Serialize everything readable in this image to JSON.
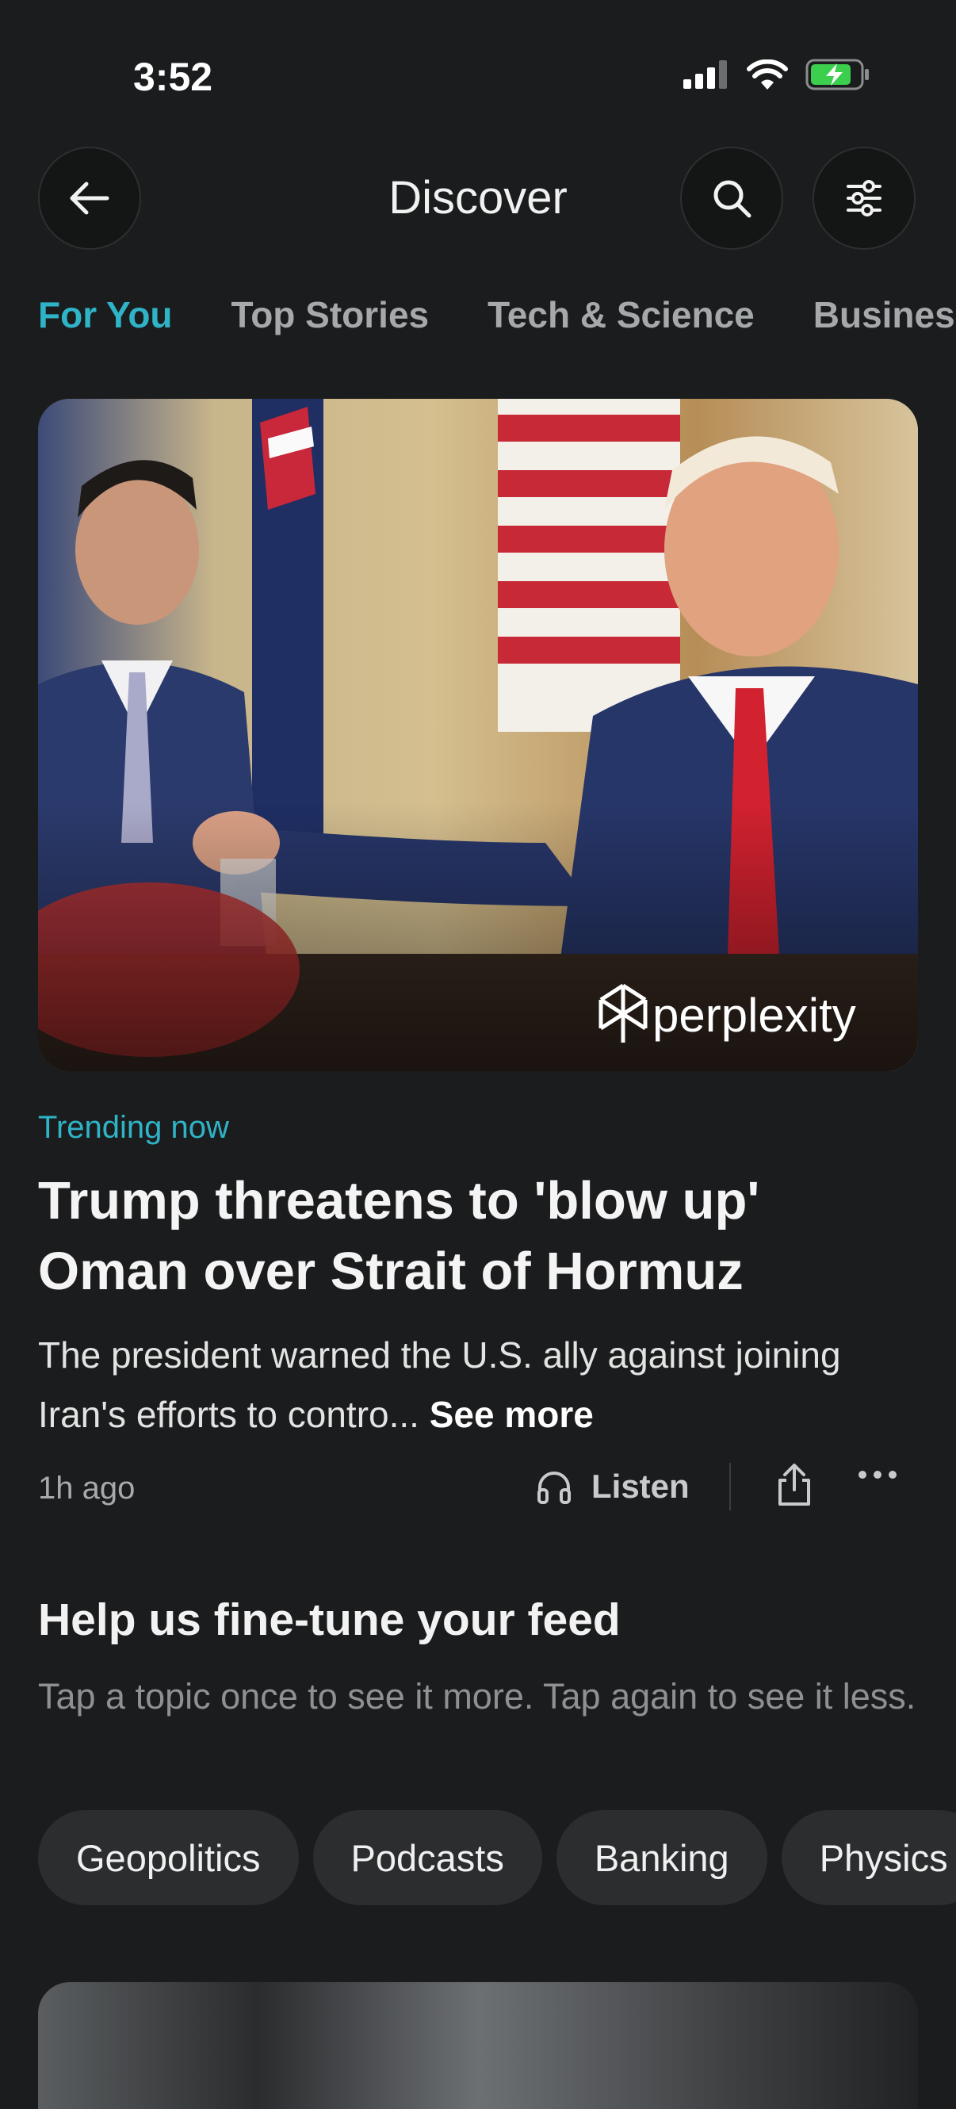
{
  "status_bar": {
    "time": "3:52"
  },
  "header": {
    "title": "Discover"
  },
  "tabs": [
    {
      "label": "For You",
      "active": true
    },
    {
      "label": "Top Stories",
      "active": false
    },
    {
      "label": "Tech & Science",
      "active": false
    },
    {
      "label": "Business",
      "active": false
    }
  ],
  "article": {
    "image_watermark": "perplexity",
    "tag": "Trending now",
    "headline": "Trump threatens to 'blow up' Oman over Strait of Hormuz",
    "summary": "The president warned the U.S. ally against joining Iran's efforts to contro...",
    "see_more": "See more",
    "time_ago": "1h ago",
    "listen_label": "Listen"
  },
  "feed_tuning": {
    "title": "Help us fine-tune your feed",
    "description": "Tap a topic once to see it more. Tap again to see it less.",
    "topics": [
      "Geopolitics",
      "Podcasts",
      "Banking",
      "Physics"
    ]
  },
  "colors": {
    "accent": "#2fb3c6",
    "background": "#1b1c1d",
    "chip_bg": "#2b2d2f"
  },
  "icons": [
    "back-arrow-icon",
    "search-icon",
    "sliders-icon",
    "headphones-icon",
    "share-icon",
    "more-icon",
    "signal-icon",
    "wifi-icon",
    "battery-icon"
  ]
}
